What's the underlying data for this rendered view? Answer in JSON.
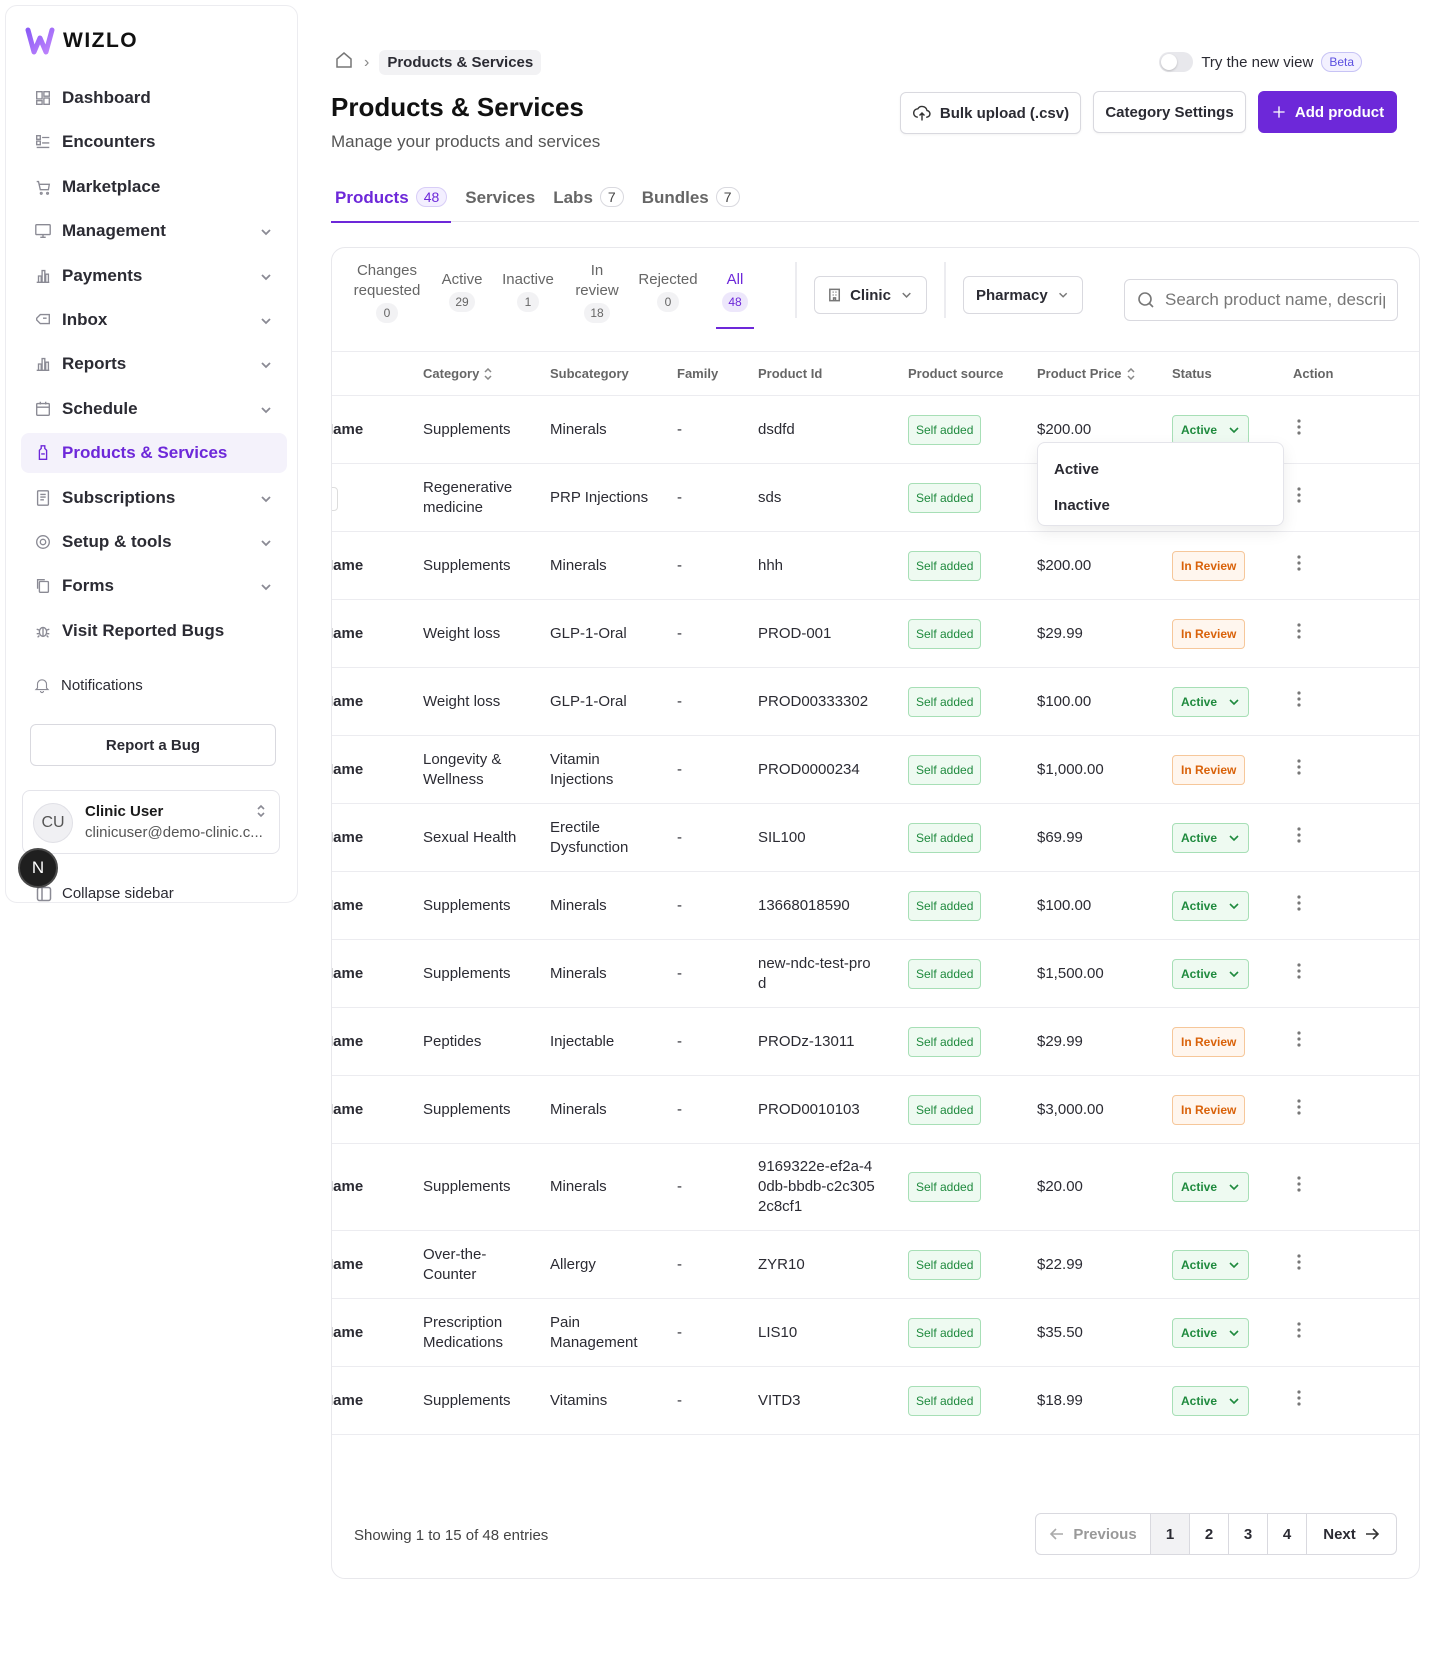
{
  "sidebar": {
    "brand": "WIZLO",
    "items": [
      {
        "label": "Dashboard",
        "icon": "dashboard-icon",
        "has_chevron": false
      },
      {
        "label": "Encounters",
        "icon": "list-icon",
        "has_chevron": false
      },
      {
        "label": "Marketplace",
        "icon": "store-icon",
        "has_chevron": false
      },
      {
        "label": "Management",
        "icon": "monitor-icon",
        "has_chevron": true
      },
      {
        "label": "Payments",
        "icon": "bar-chart-icon",
        "has_chevron": true
      },
      {
        "label": "Inbox",
        "icon": "inbox-icon",
        "has_chevron": true
      },
      {
        "label": "Reports",
        "icon": "bar-chart-icon",
        "has_chevron": true
      },
      {
        "label": "Schedule",
        "icon": "calendar-icon",
        "has_chevron": true
      },
      {
        "label": "Products & Services",
        "icon": "bottle-icon",
        "has_chevron": false,
        "active": true
      },
      {
        "label": "Subscriptions",
        "icon": "document-icon",
        "has_chevron": true
      },
      {
        "label": "Setup & tools",
        "icon": "gear-icon",
        "has_chevron": true
      },
      {
        "label": "Forms",
        "icon": "copy-icon",
        "has_chevron": true
      },
      {
        "label": "Visit Reported Bugs",
        "icon": "bug-icon",
        "has_chevron": false
      }
    ],
    "notifications": "Notifications",
    "report_bug": "Report a Bug",
    "user": {
      "initials": "CU",
      "name": "Clinic User",
      "email": "clinicuser@demo-clinic.c..."
    },
    "n_badge": "N",
    "collapse": "Collapse sidebar"
  },
  "header": {
    "breadcrumb": "Products & Services",
    "view_toggle_label": "Try the new view",
    "beta": "Beta",
    "title": "Products & Services",
    "subtitle": "Manage your products and services",
    "bulk_upload": "Bulk upload (.csv)",
    "category_settings": "Category Settings",
    "add_product": "Add product"
  },
  "tabs": [
    {
      "label": "Products",
      "count": "48",
      "active": true
    },
    {
      "label": "Services",
      "count": ""
    },
    {
      "label": "Labs",
      "count": "7"
    },
    {
      "label": "Bundles",
      "count": "7"
    }
  ],
  "filters": {
    "status_tabs": [
      {
        "label": "Changes requested",
        "count": "0"
      },
      {
        "label": "Active",
        "count": "29"
      },
      {
        "label": "Inactive",
        "count": "1"
      },
      {
        "label": "In review",
        "count": "18"
      },
      {
        "label": "Rejected",
        "count": "0"
      },
      {
        "label": "All",
        "count": "48",
        "active": true
      }
    ],
    "clinic": "Clinic",
    "pharmacy": "Pharmacy",
    "search_placeholder": "Search product name, description"
  },
  "table": {
    "columns": [
      "Category",
      "Subcategory",
      "Family",
      "Product Id",
      "Product source",
      "Product Price",
      "Status",
      "Action"
    ],
    "rows": [
      {
        "name": "l Name",
        "category": "Supplements",
        "subcategory": "Minerals",
        "family": "-",
        "product_id": "dsdfd",
        "source": "Self added",
        "price": "$200.00",
        "status": "Active"
      },
      {
        "name": "",
        "category": "Regenerative medicine",
        "subcategory": "PRP Injections",
        "family": "-",
        "product_id": "sds",
        "source": "Self added",
        "price": "",
        "status": ""
      },
      {
        "name": "l Name",
        "category": "Supplements",
        "subcategory": "Minerals",
        "family": "-",
        "product_id": "hhh",
        "source": "Self added",
        "price": "$200.00",
        "status": "In Review"
      },
      {
        "name": "l Name",
        "category": "Weight loss",
        "subcategory": "GLP-1-Oral",
        "family": "-",
        "product_id": "PROD-001",
        "source": "Self added",
        "price": "$29.99",
        "status": "In Review"
      },
      {
        "name": "l Name",
        "category": "Weight loss",
        "subcategory": "GLP-1-Oral",
        "family": "-",
        "product_id": "PROD00333302",
        "source": "Self added",
        "price": "$100.00",
        "status": "Active"
      },
      {
        "name": "l Name",
        "category": "Longevity & Wellness",
        "subcategory": "Vitamin Injections",
        "family": "-",
        "product_id": "PROD0000234",
        "source": "Self added",
        "price": "$1,000.00",
        "status": "In Review"
      },
      {
        "name": "l Name",
        "category": "Sexual Health",
        "subcategory": "Erectile Dysfunction",
        "family": "-",
        "product_id": "SIL100",
        "source": "Self added",
        "price": "$69.99",
        "status": "Active"
      },
      {
        "name": "l Name",
        "category": "Supplements",
        "subcategory": "Minerals",
        "family": "-",
        "product_id": "13668018590",
        "source": "Self added",
        "price": "$100.00",
        "status": "Active"
      },
      {
        "name": "l Name",
        "category": "Supplements",
        "subcategory": "Minerals",
        "family": "-",
        "product_id": "new-ndc-test-prod",
        "source": "Self added",
        "price": "$1,500.00",
        "status": "Active"
      },
      {
        "name": "l Name",
        "category": "Peptides",
        "subcategory": "Injectable",
        "family": "-",
        "product_id": "PRODz-13011",
        "source": "Self added",
        "price": "$29.99",
        "status": "In Review"
      },
      {
        "name": "l Name",
        "category": "Supplements",
        "subcategory": "Minerals",
        "family": "-",
        "product_id": "PROD0010103",
        "source": "Self added",
        "price": "$3,000.00",
        "status": "In Review"
      },
      {
        "name": "l Name",
        "category": "Supplements",
        "subcategory": "Minerals",
        "family": "-",
        "product_id": "9169322e-ef2a-40db-bbdb-c2c3052c8cf1",
        "source": "Self added",
        "price": "$20.00",
        "status": "Active"
      },
      {
        "name": "l Name",
        "category": "Over-the-Counter",
        "subcategory": "Allergy",
        "family": "-",
        "product_id": "ZYR10",
        "source": "Self added",
        "price": "$22.99",
        "status": "Active"
      },
      {
        "name": "l Name",
        "category": "Prescription Medications",
        "subcategory": "Pain Management",
        "family": "-",
        "product_id": "LIS10",
        "source": "Self added",
        "price": "$35.50",
        "status": "Active"
      },
      {
        "name": "l Name",
        "category": "Supplements",
        "subcategory": "Vitamins",
        "family": "-",
        "product_id": "VITD3",
        "source": "Self added",
        "price": "$18.99",
        "status": "Active"
      }
    ]
  },
  "status_dropdown": {
    "options": [
      "Active",
      "Inactive"
    ]
  },
  "footer": {
    "showing": "Showing 1 to 15 of 48 entries",
    "previous": "Previous",
    "pages": [
      "1",
      "2",
      "3",
      "4"
    ],
    "next": "Next"
  },
  "colors": {
    "accent": "#6d28d9",
    "success": "#1f8a3e",
    "warning": "#d9620a"
  }
}
